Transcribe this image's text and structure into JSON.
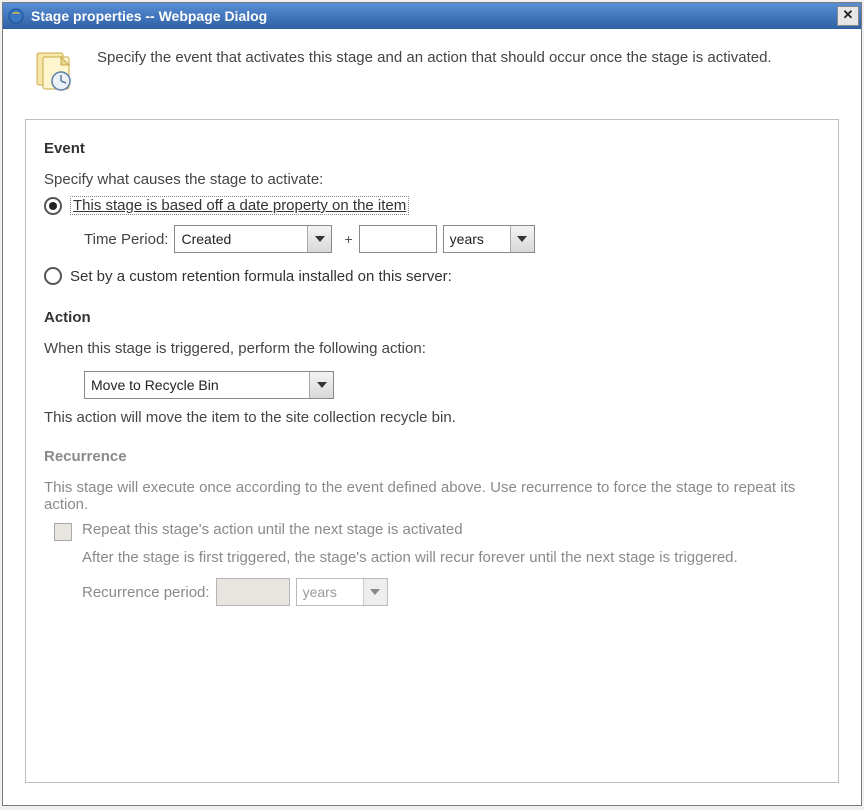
{
  "title": "Stage properties -- Webpage Dialog",
  "header_description": "Specify the event that activates this stage and an action that should occur once the stage is activated.",
  "event": {
    "title": "Event",
    "prompt": "Specify what causes the stage to activate:",
    "option1_label": "This stage is based off a date property on the item",
    "time_period_label": "Time Period:",
    "time_property_selected": "Created",
    "time_value": "",
    "time_unit_selected": "years",
    "option2_label": "Set by a custom retention formula installed on this server:"
  },
  "action": {
    "title": "Action",
    "prompt": "When this stage is triggered, perform the following action:",
    "selected": "Move to Recycle Bin",
    "description": "This action will move the item to the site collection recycle bin."
  },
  "recurrence": {
    "title": "Recurrence",
    "intro": "This stage will execute once according to the event defined above. Use recurrence to force the stage to repeat its action.",
    "checkbox_label": "Repeat this stage's action until the next stage is activated",
    "sub_desc": "After the stage is first triggered, the stage's action will recur forever until the next stage is triggered.",
    "period_label": "Recurrence period:",
    "period_value": "",
    "period_unit": "years"
  }
}
